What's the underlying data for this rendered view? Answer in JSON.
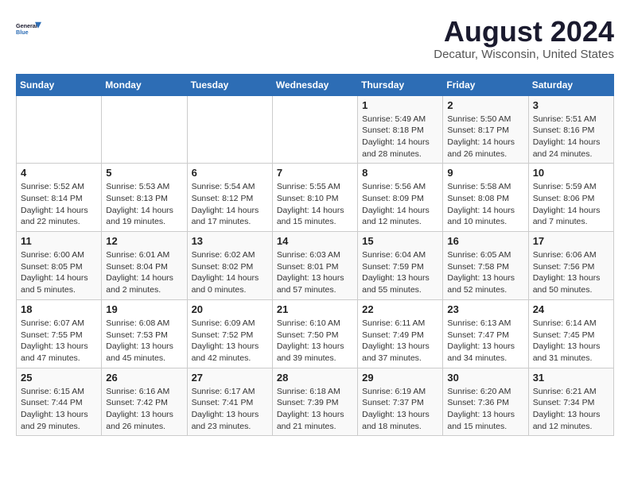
{
  "logo": {
    "line1": "General",
    "line2": "Blue"
  },
  "title": "August 2024",
  "location": "Decatur, Wisconsin, United States",
  "weekdays": [
    "Sunday",
    "Monday",
    "Tuesday",
    "Wednesday",
    "Thursday",
    "Friday",
    "Saturday"
  ],
  "weeks": [
    [
      {
        "day": "",
        "info": ""
      },
      {
        "day": "",
        "info": ""
      },
      {
        "day": "",
        "info": ""
      },
      {
        "day": "",
        "info": ""
      },
      {
        "day": "1",
        "info": "Sunrise: 5:49 AM\nSunset: 8:18 PM\nDaylight: 14 hours\nand 28 minutes."
      },
      {
        "day": "2",
        "info": "Sunrise: 5:50 AM\nSunset: 8:17 PM\nDaylight: 14 hours\nand 26 minutes."
      },
      {
        "day": "3",
        "info": "Sunrise: 5:51 AM\nSunset: 8:16 PM\nDaylight: 14 hours\nand 24 minutes."
      }
    ],
    [
      {
        "day": "4",
        "info": "Sunrise: 5:52 AM\nSunset: 8:14 PM\nDaylight: 14 hours\nand 22 minutes."
      },
      {
        "day": "5",
        "info": "Sunrise: 5:53 AM\nSunset: 8:13 PM\nDaylight: 14 hours\nand 19 minutes."
      },
      {
        "day": "6",
        "info": "Sunrise: 5:54 AM\nSunset: 8:12 PM\nDaylight: 14 hours\nand 17 minutes."
      },
      {
        "day": "7",
        "info": "Sunrise: 5:55 AM\nSunset: 8:10 PM\nDaylight: 14 hours\nand 15 minutes."
      },
      {
        "day": "8",
        "info": "Sunrise: 5:56 AM\nSunset: 8:09 PM\nDaylight: 14 hours\nand 12 minutes."
      },
      {
        "day": "9",
        "info": "Sunrise: 5:58 AM\nSunset: 8:08 PM\nDaylight: 14 hours\nand 10 minutes."
      },
      {
        "day": "10",
        "info": "Sunrise: 5:59 AM\nSunset: 8:06 PM\nDaylight: 14 hours\nand 7 minutes."
      }
    ],
    [
      {
        "day": "11",
        "info": "Sunrise: 6:00 AM\nSunset: 8:05 PM\nDaylight: 14 hours\nand 5 minutes."
      },
      {
        "day": "12",
        "info": "Sunrise: 6:01 AM\nSunset: 8:04 PM\nDaylight: 14 hours\nand 2 minutes."
      },
      {
        "day": "13",
        "info": "Sunrise: 6:02 AM\nSunset: 8:02 PM\nDaylight: 14 hours\nand 0 minutes."
      },
      {
        "day": "14",
        "info": "Sunrise: 6:03 AM\nSunset: 8:01 PM\nDaylight: 13 hours\nand 57 minutes."
      },
      {
        "day": "15",
        "info": "Sunrise: 6:04 AM\nSunset: 7:59 PM\nDaylight: 13 hours\nand 55 minutes."
      },
      {
        "day": "16",
        "info": "Sunrise: 6:05 AM\nSunset: 7:58 PM\nDaylight: 13 hours\nand 52 minutes."
      },
      {
        "day": "17",
        "info": "Sunrise: 6:06 AM\nSunset: 7:56 PM\nDaylight: 13 hours\nand 50 minutes."
      }
    ],
    [
      {
        "day": "18",
        "info": "Sunrise: 6:07 AM\nSunset: 7:55 PM\nDaylight: 13 hours\nand 47 minutes."
      },
      {
        "day": "19",
        "info": "Sunrise: 6:08 AM\nSunset: 7:53 PM\nDaylight: 13 hours\nand 45 minutes."
      },
      {
        "day": "20",
        "info": "Sunrise: 6:09 AM\nSunset: 7:52 PM\nDaylight: 13 hours\nand 42 minutes."
      },
      {
        "day": "21",
        "info": "Sunrise: 6:10 AM\nSunset: 7:50 PM\nDaylight: 13 hours\nand 39 minutes."
      },
      {
        "day": "22",
        "info": "Sunrise: 6:11 AM\nSunset: 7:49 PM\nDaylight: 13 hours\nand 37 minutes."
      },
      {
        "day": "23",
        "info": "Sunrise: 6:13 AM\nSunset: 7:47 PM\nDaylight: 13 hours\nand 34 minutes."
      },
      {
        "day": "24",
        "info": "Sunrise: 6:14 AM\nSunset: 7:45 PM\nDaylight: 13 hours\nand 31 minutes."
      }
    ],
    [
      {
        "day": "25",
        "info": "Sunrise: 6:15 AM\nSunset: 7:44 PM\nDaylight: 13 hours\nand 29 minutes."
      },
      {
        "day": "26",
        "info": "Sunrise: 6:16 AM\nSunset: 7:42 PM\nDaylight: 13 hours\nand 26 minutes."
      },
      {
        "day": "27",
        "info": "Sunrise: 6:17 AM\nSunset: 7:41 PM\nDaylight: 13 hours\nand 23 minutes."
      },
      {
        "day": "28",
        "info": "Sunrise: 6:18 AM\nSunset: 7:39 PM\nDaylight: 13 hours\nand 21 minutes."
      },
      {
        "day": "29",
        "info": "Sunrise: 6:19 AM\nSunset: 7:37 PM\nDaylight: 13 hours\nand 18 minutes."
      },
      {
        "day": "30",
        "info": "Sunrise: 6:20 AM\nSunset: 7:36 PM\nDaylight: 13 hours\nand 15 minutes."
      },
      {
        "day": "31",
        "info": "Sunrise: 6:21 AM\nSunset: 7:34 PM\nDaylight: 13 hours\nand 12 minutes."
      }
    ]
  ]
}
